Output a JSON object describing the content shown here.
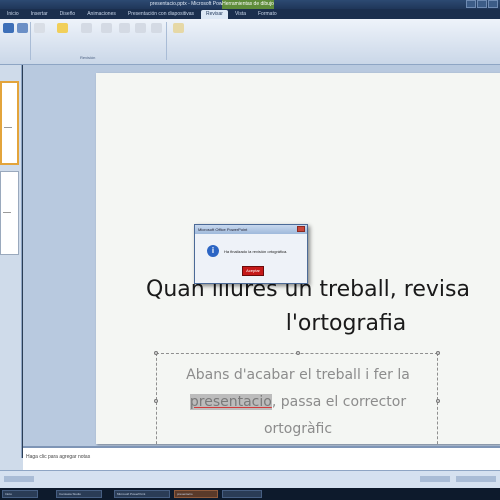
{
  "window": {
    "title": "presentacio.pptx - Microsoft PowerPoint",
    "context_tab": "Herramientas de dibujo"
  },
  "ribbon": {
    "tabs": [
      "Inicio",
      "Insertar",
      "Diseño",
      "Animaciones",
      "Presentación con diapositivas",
      "Revisar",
      "Vista",
      "Formato"
    ],
    "active_tab": "Revisar",
    "group_label": "Revisión"
  },
  "slide": {
    "title_line1": "Quan lliures un treball, revisa",
    "title_line2": "l'ortografia",
    "body_before": "Abans d'acabar el treball i fer la",
    "body_highlight": "presentacio",
    "body_after": ", passa el corrector",
    "body_line3": "ortogràfic"
  },
  "dialog": {
    "title": "Microsoft Office PowerPoint",
    "message": "Ha finalizado la revisión ortográfica.",
    "ok_label": "Aceptar",
    "icon": "info-icon"
  },
  "notes": {
    "placeholder": "Haga clic para agregar notas"
  },
  "taskbar": {
    "items": [
      "Inicio",
      "Camtasia Studio",
      "Microsoft PowerPoint",
      "presentacio"
    ]
  },
  "colors": {
    "accent": "#5e8c3a",
    "dialog_button": "#c51919",
    "slide_bg": "#f4f6f3"
  }
}
